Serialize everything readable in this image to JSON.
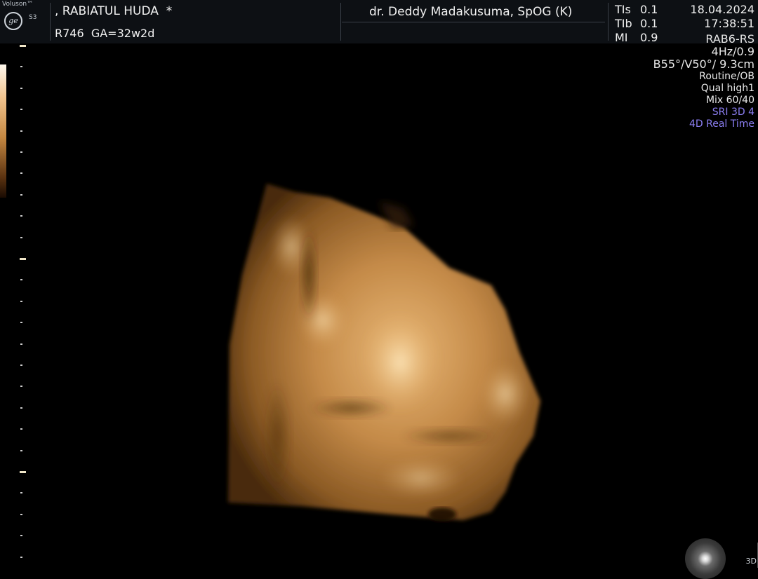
{
  "device": {
    "brand": "Voluson™",
    "model": "S3",
    "logo_icon": "ge-logo-icon"
  },
  "patient": {
    "name": ", RABIATUL HUDA  *",
    "study": "R746  GA=32w2d"
  },
  "operator": "dr. Deddy Madakusuma, SpOG (K)",
  "indices": [
    {
      "label": "TIs",
      "value": "0.1"
    },
    {
      "label": "TIb",
      "value": "0.1"
    },
    {
      "label": "MI",
      "value": "0.9"
    }
  ],
  "date": "18.04.2024",
  "time": "17:38:51",
  "params": {
    "probe": "RAB6-RS",
    "frame_rate": "4Hz/0.9",
    "geometry": "B55°/V50°/ 9.3cm",
    "preset": "Routine/OB",
    "quality": "Qual high1",
    "mix": "Mix 60/40",
    "sri": "SRI 3D 4",
    "mode": "4D Real Time"
  },
  "render_mode_label": "3D",
  "colors": {
    "background": "#000000",
    "header": "#0d1014",
    "accent_blue": "#8a7df0",
    "render_tone": "#c48a48"
  }
}
